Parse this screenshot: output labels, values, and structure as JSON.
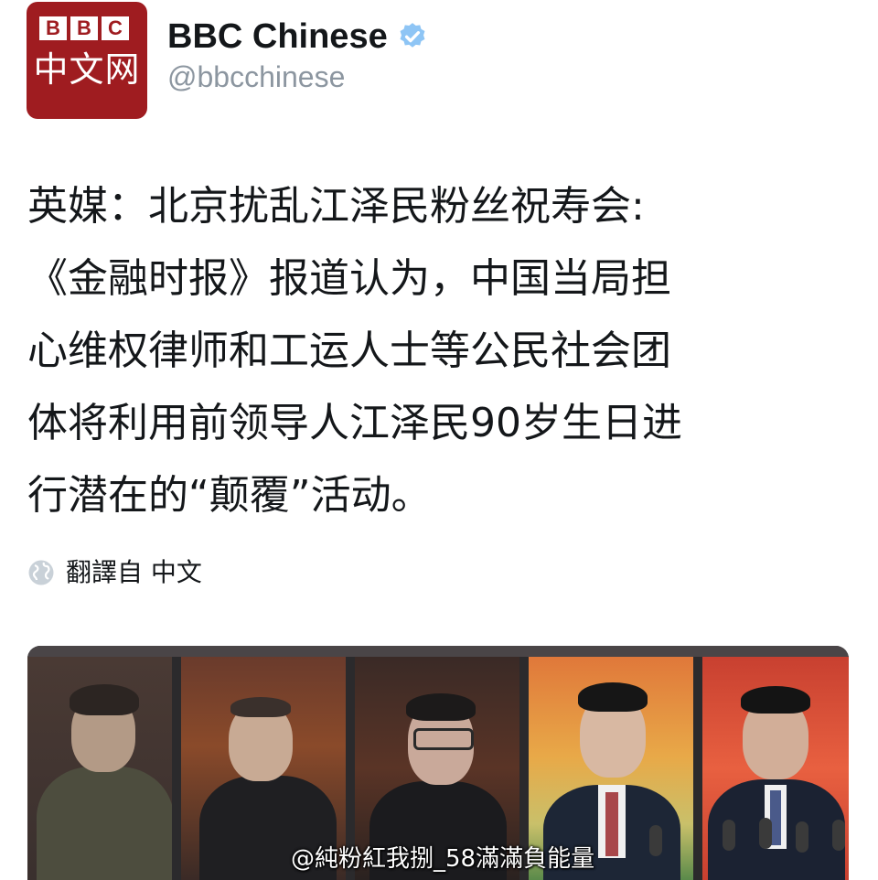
{
  "account": {
    "avatar_top": "BBC",
    "avatar_bottom": "中文网",
    "display_name": "BBC Chinese",
    "handle": "@bbcchinese",
    "verified_icon": "verified-badge-icon"
  },
  "tweet": {
    "text": "英媒：北京扰乱江泽民粉丝祝寿会:\n《金融时报》报道认为，中国当局担\n心维权律师和工运人士等公民社会团\n体将利用前领导人江泽民90岁生日进\n行潜在的“颠覆”活动。",
    "translate_label": "翻譯自 中文"
  },
  "media": {
    "description_icon": "photo-portraits"
  },
  "watermark": "@純粉紅我捌_58滿滿負能量",
  "colors": {
    "bbc_red": "#9f1c20",
    "verified_blue": "#1da1f2",
    "handle_gray": "#8c96a0",
    "text": "#14171a"
  }
}
